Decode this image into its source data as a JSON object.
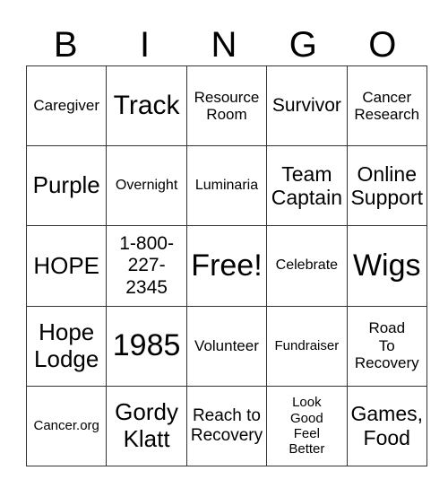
{
  "header": {
    "letters": [
      "B",
      "I",
      "N",
      "G",
      "O"
    ]
  },
  "grid": {
    "rows": [
      [
        "Caregiver",
        "Track",
        "Resource Room",
        "Survivor",
        "Cancer Research"
      ],
      [
        "Purple",
        "Overnight",
        "Luminaria",
        "Team Captain",
        "Online Support"
      ],
      [
        "HOPE",
        "1-800-227-2345",
        "Free!",
        "Celebrate",
        "Wigs"
      ],
      [
        "Hope Lodge",
        "1985",
        "Volunteer",
        "Fundraiser",
        "Road To Recovery"
      ],
      [
        "Cancer.org",
        "Gordy Klatt",
        "Reach to Recovery",
        "Look Good Feel Better",
        "Games, Food"
      ]
    ],
    "display_lines": [
      [
        [
          "Caregiver"
        ],
        [
          "Track"
        ],
        [
          "Resource",
          "Room"
        ],
        [
          "Survivor"
        ],
        [
          "Cancer",
          "Research"
        ]
      ],
      [
        [
          "Purple"
        ],
        [
          "Overnight"
        ],
        [
          "Luminaria"
        ],
        [
          "Team",
          "Captain"
        ],
        [
          "Online",
          "Support"
        ]
      ],
      [
        [
          "HOPE"
        ],
        [
          "1-800-",
          "227-",
          "2345"
        ],
        [
          "Free!"
        ],
        [
          "Celebrate"
        ],
        [
          "Wigs"
        ]
      ],
      [
        [
          "Hope",
          "Lodge"
        ],
        [
          "1985"
        ],
        [
          "Volunteer"
        ],
        [
          "Fundraiser"
        ],
        [
          "Road",
          "To",
          "Recovery"
        ]
      ],
      [
        [
          "Cancer.org"
        ],
        [
          "Gordy",
          "Klatt"
        ],
        [
          "Reach to",
          "Recovery"
        ],
        [
          "Look",
          "Good",
          "Feel",
          "Better"
        ],
        [
          "Games,",
          "Food"
        ]
      ]
    ]
  }
}
